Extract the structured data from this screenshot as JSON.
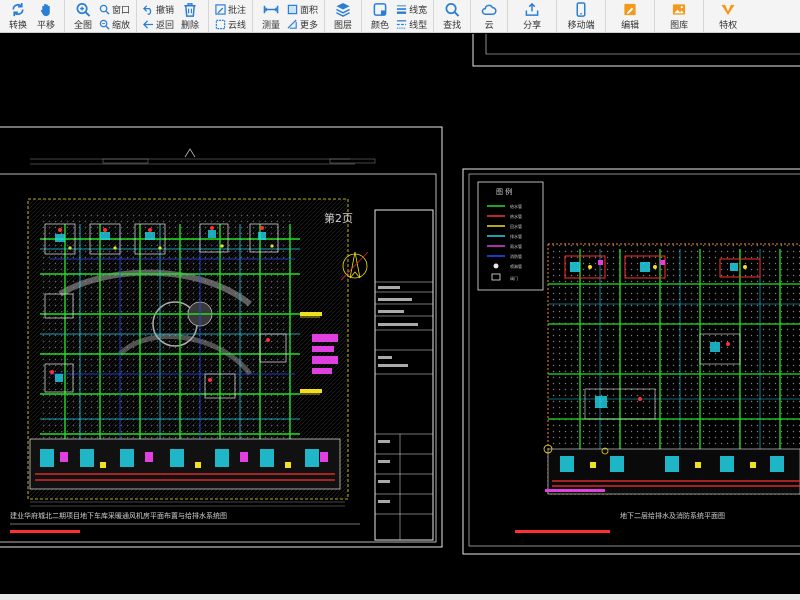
{
  "toolbar": {
    "rotate": "转换",
    "pan": "平移",
    "fit": "全图",
    "window": "窗口",
    "zoom": "缩放",
    "undo": "撤销",
    "back": "返回",
    "delete": "删除",
    "annotate": "批注",
    "cloud_line": "云线",
    "measure": "测量",
    "area": "面积",
    "more": "更多",
    "layers": "图层",
    "color": "颜色",
    "line_width": "线宽",
    "line_type": "线型",
    "find": "查找",
    "cloud": "云",
    "share": "分享",
    "mobile": "移动端",
    "edit": "编辑",
    "library": "图库",
    "privilege": "特权"
  },
  "drawing": {
    "left_caption": "建业华府城北二期项目地下车库采暖通风机房平面布置与给排水系统图",
    "left_number": "第2页",
    "right_caption": "地下二层给排水及消防系统平面图",
    "legend_title": "图 例",
    "legend_items": [
      "给水管",
      "热水管",
      "回水管",
      "排水管",
      "雨水管",
      "消防管",
      "喷淋管",
      "阀门"
    ],
    "title_block": [
      "建设单位",
      "工程名称",
      "图纸名称"
    ]
  },
  "colors": {
    "toolbar_bg": "#f4f4f4",
    "icon_blue": "#2a7fd4",
    "icon_orange": "#f39a1e",
    "canvas_bg": "#000000",
    "cad_green": "#22e022",
    "cad_cyan": "#22d4e8",
    "cad_red": "#ff3030",
    "cad_yellow": "#f0e020",
    "cad_magenta": "#e040e0",
    "cad_white": "#e8e8e8"
  }
}
